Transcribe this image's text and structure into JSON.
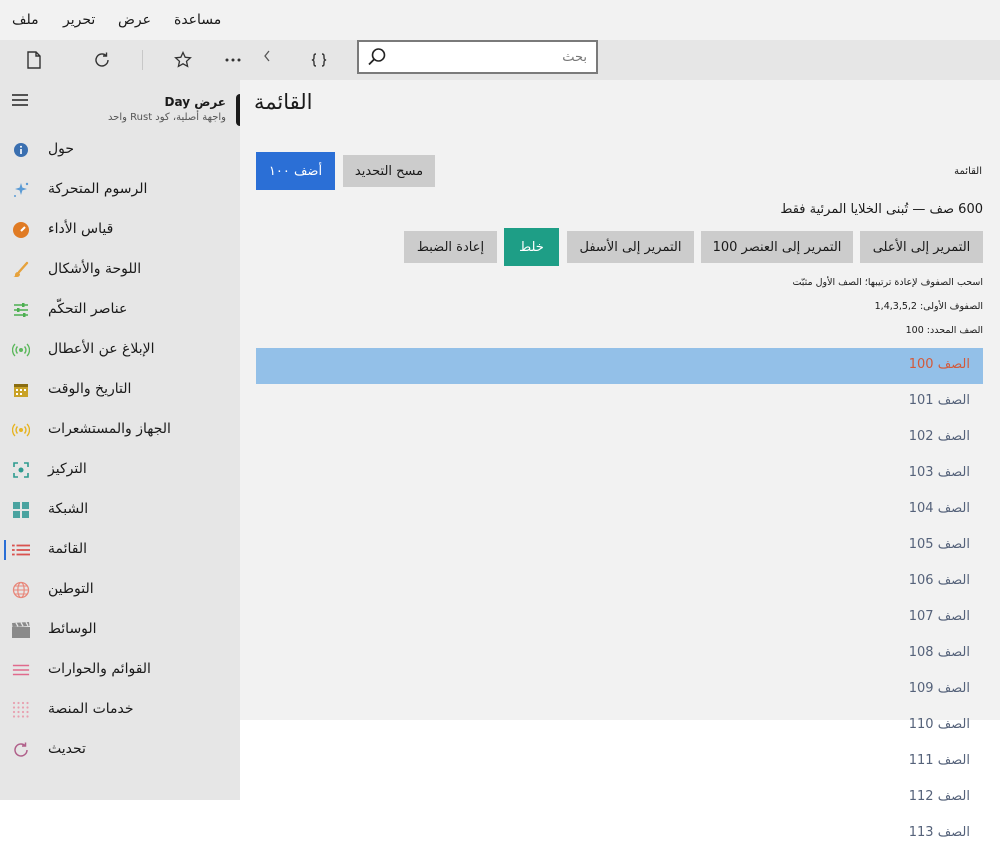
{
  "menu": [
    "ملف",
    "تحرير",
    "عرض",
    "مساعدة"
  ],
  "toolbar": {
    "icons": [
      "document-icon",
      "refresh-icon",
      "star-icon",
      "more-icon",
      "chevron-left-icon",
      "braces-icon"
    ],
    "search_placeholder": "بحث"
  },
  "app": {
    "title": "عرض Day",
    "subtitle": "واجهة أصلية، كود Rust واحد"
  },
  "sidebar": {
    "items": [
      {
        "label": "حول",
        "icon": "info-icon",
        "color": "#3a6fb0"
      },
      {
        "label": "الرسوم المتحركة",
        "icon": "sparkle-icon",
        "color": "#5b9bd5"
      },
      {
        "label": "قياس الأداء",
        "icon": "gauge-icon",
        "color": "#e07b24"
      },
      {
        "label": "اللوحة والأشكال",
        "icon": "brush-icon",
        "color": "#e6a23c"
      },
      {
        "label": "عناصر التحكّم",
        "icon": "sliders-icon",
        "color": "#4caf50"
      },
      {
        "label": "الإبلاغ عن الأعطال",
        "icon": "broadcast-icon",
        "color": "#5cb85c"
      },
      {
        "label": "التاريخ والوقت",
        "icon": "calendar-icon",
        "color": "#c9a227"
      },
      {
        "label": "الجهاز والمستشعرات",
        "icon": "sensor-icon",
        "color": "#e6b422"
      },
      {
        "label": "التركيز",
        "icon": "focus-icon",
        "color": "#2e9b8f"
      },
      {
        "label": "الشبكة",
        "icon": "grid-icon",
        "color": "#4aa3a0"
      },
      {
        "label": "القائمة",
        "icon": "list-icon",
        "color": "#d9534f"
      },
      {
        "label": "التوطين",
        "icon": "globe-icon",
        "color": "#e8877a"
      },
      {
        "label": "الوسائط",
        "icon": "clapper-icon",
        "color": "#8a8a8a"
      },
      {
        "label": "القوائم والحوارات",
        "icon": "menu-lines-icon",
        "color": "#e06a8c"
      },
      {
        "label": "خدمات المنصة",
        "icon": "dots-grid-icon",
        "color": "#e8a0b0"
      },
      {
        "label": "تحديث",
        "icon": "update-icon",
        "color": "#b0608a"
      }
    ],
    "selected_index": 10
  },
  "main": {
    "title": "القائمة",
    "section_label": "القائمة",
    "add_button": "أضف ١٠٠",
    "clear_selection_button": "مسح التحديد",
    "info_line": "600 صف — تُبنى الخلايا المرئية فقط",
    "actions": {
      "scroll_top": "التمرير إلى الأعلى",
      "scroll_to_100": "التمرير إلى العنصر 100",
      "scroll_bottom": "التمرير إلى الأسفل",
      "shuffle": "خلط",
      "reset": "إعادة الضبط"
    },
    "drag_hint": "اسحب الصفوف لإعادة ترتيبها؛ الصف الأول مثبّت",
    "first_rows": "الصفوف الأولى: 1,4,3,5,2",
    "selected_row": "الصف المحدد: 100",
    "rows": [
      "الصف 100",
      "الصف 101",
      "الصف 102",
      "الصف 103",
      "الصف 104",
      "الصف 105",
      "الصف 106",
      "الصف 107",
      "الصف 108",
      "الصف 109",
      "الصف 110",
      "الصف 111",
      "الصف 112",
      "الصف 113"
    ],
    "selected_row_index": 0
  },
  "colors": {
    "accent": "#2b6fd6",
    "shuffle": "#1e9e86",
    "selected_row_bg": "#93c0e8",
    "selected_row_text": "#d35a3a"
  }
}
